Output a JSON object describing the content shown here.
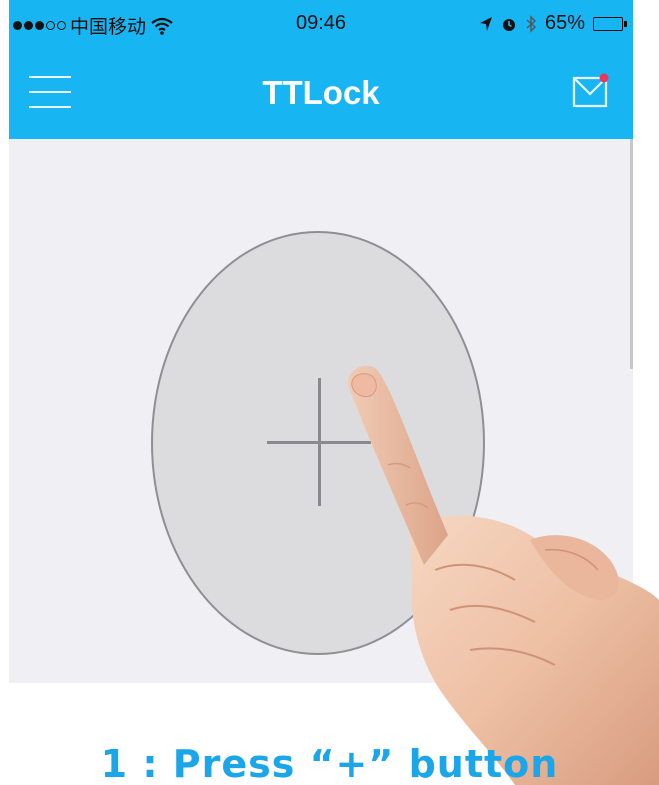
{
  "status_bar": {
    "carrier": "中国移动",
    "time": "09:46",
    "battery": "65%",
    "battery_level": 0.65
  },
  "nav": {
    "title": "TTLock"
  },
  "caption": "1 : Press “+” button",
  "colors": {
    "accent": "#18b5f3",
    "background": "#efeff4",
    "button_fill": "#dcdcde",
    "caption": "#1aa6e8",
    "notification_dot": "#e8365d"
  },
  "icons": {
    "menu": "hamburger-menu-icon",
    "mail": "mail-icon",
    "add": "plus-icon",
    "hand": "pointing-hand"
  }
}
